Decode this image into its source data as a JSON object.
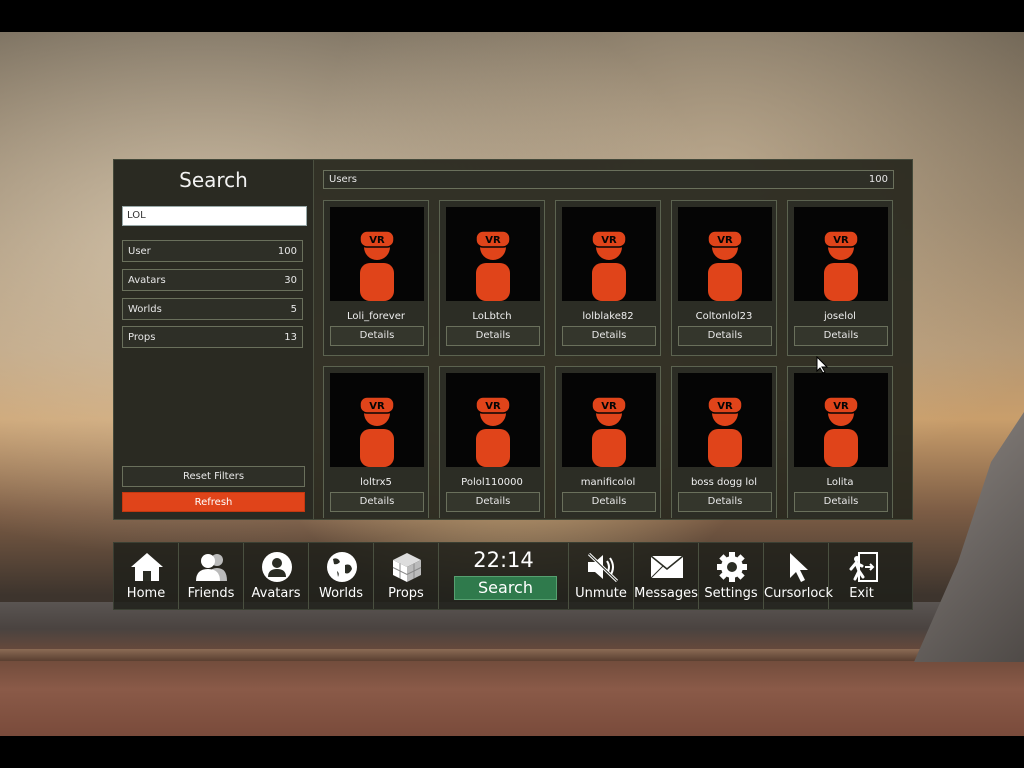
{
  "search": {
    "title": "Search",
    "query": "LOL",
    "filters": [
      {
        "label": "User",
        "count": "100"
      },
      {
        "label": "Avatars",
        "count": "30"
      },
      {
        "label": "Worlds",
        "count": "5"
      },
      {
        "label": "Props",
        "count": "13"
      }
    ],
    "reset_label": "Reset Filters",
    "refresh_label": "Refresh"
  },
  "results": {
    "header_label": "Users",
    "header_count": "100",
    "thumb_badge": "VR",
    "details_label": "Details",
    "users": [
      "Loli_forever",
      "LoLbtch",
      "lolblake82",
      "Coltonlol23",
      "joselol",
      "loltrx5",
      "Polol110000",
      "manificolol",
      "boss dogg lol",
      "Lolita"
    ]
  },
  "menu": {
    "time": "22:14",
    "active_label": "Search",
    "left": [
      {
        "label": "Home",
        "icon": "home-icon"
      },
      {
        "label": "Friends",
        "icon": "friends-icon"
      },
      {
        "label": "Avatars",
        "icon": "avatar-icon"
      },
      {
        "label": "Worlds",
        "icon": "globe-icon"
      },
      {
        "label": "Props",
        "icon": "cube-icon"
      }
    ],
    "right": [
      {
        "label": "Unmute",
        "icon": "muted-speaker-icon"
      },
      {
        "label": "Messages",
        "icon": "envelope-icon"
      },
      {
        "label": "Settings",
        "icon": "gear-icon"
      },
      {
        "label": "Cursorlock",
        "icon": "cursor-icon"
      },
      {
        "label": "Exit",
        "icon": "exit-icon"
      }
    ]
  },
  "colors": {
    "accent_orange": "#e0441a",
    "active_green": "#2f7a4c"
  }
}
